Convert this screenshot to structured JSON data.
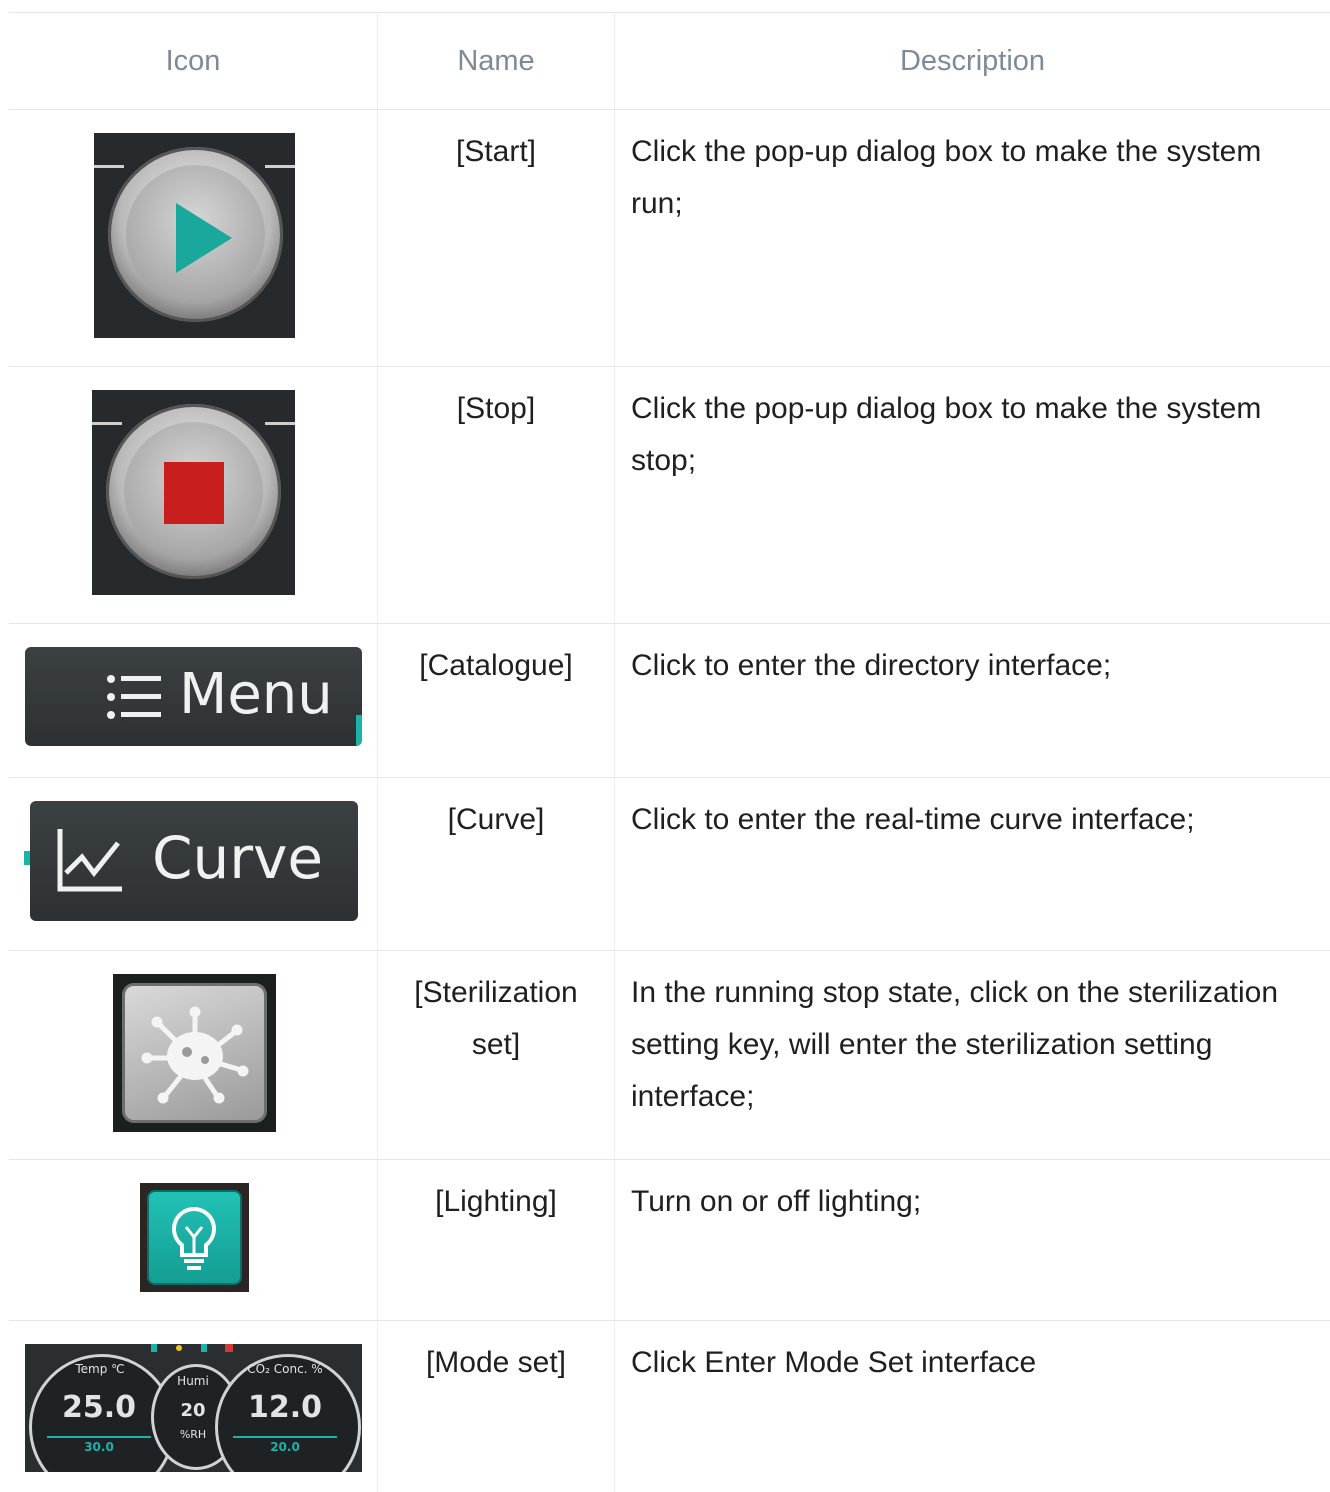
{
  "header": {
    "icon": "Icon",
    "name": "Name",
    "description": "Description"
  },
  "rows": [
    {
      "icon": "play-icon",
      "name": "[Start]",
      "description": "Click the pop-up dialog box to make the system run;"
    },
    {
      "icon": "stop-icon",
      "name": "[Stop]",
      "description": "Click the pop-up dialog box to make the system stop;"
    },
    {
      "icon": "menu-icon",
      "icon_label": "Menu",
      "name": "[Catalogue]",
      "description": "Click to enter the directory interface;"
    },
    {
      "icon": "chart-line-icon",
      "icon_label": "Curve",
      "name": "[Curve]",
      "description": "Click to enter the real-time curve interface;"
    },
    {
      "icon": "virus-icon",
      "name": "[Sterilization set]",
      "description": "In the running stop state, click on the sterilization setting key, will enter the sterilization setting interface;"
    },
    {
      "icon": "lightbulb-icon",
      "name": "[Lighting]",
      "description": "Turn on or off lighting;"
    },
    {
      "icon": "gauge-panel-icon",
      "name": "[Mode set]",
      "description": "Click Enter Mode Set interface",
      "gauge": {
        "temp_label": "Temp ℃",
        "temp_value": "25.0",
        "temp_set": "30.0",
        "humi_label": "Humi",
        "humi_value": "20",
        "humi_unit": "%RH",
        "co2_label": "CO₂ Conc. %",
        "co2_value": "12.0",
        "co2_set": "20.0"
      }
    }
  ],
  "colors": {
    "accent": "#19b3a8",
    "stop_red": "#c81e1e",
    "header_text": "#7d8b98"
  }
}
